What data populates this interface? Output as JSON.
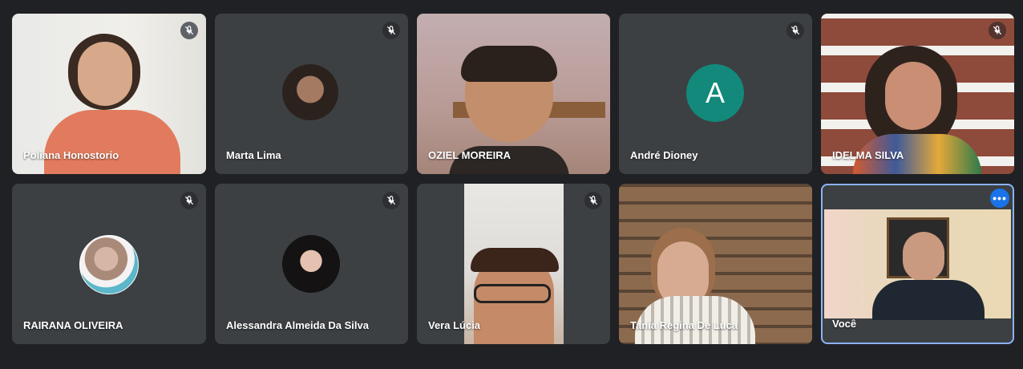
{
  "participants": [
    {
      "name": "Poliana Honostorio",
      "muted": true,
      "mode": "video"
    },
    {
      "name": "Marta Lima",
      "muted": true,
      "mode": "photo"
    },
    {
      "name": "OZIEL MOREIRA",
      "muted": false,
      "mode": "video"
    },
    {
      "name": "André Dioney",
      "muted": true,
      "mode": "letter",
      "initial": "A"
    },
    {
      "name": "IDELMA SILVA",
      "muted": true,
      "mode": "video"
    },
    {
      "name": "RAIRANA OLIVEIRA",
      "muted": true,
      "mode": "photo"
    },
    {
      "name": "Alessandra Almeida Da Silva",
      "muted": true,
      "mode": "photo"
    },
    {
      "name": "Vera Lúcia",
      "muted": true,
      "mode": "video"
    },
    {
      "name": "Tania Regina De Luca",
      "muted": false,
      "mode": "video"
    },
    {
      "name": "Você",
      "muted": false,
      "mode": "video",
      "self": true
    }
  ],
  "icons": {
    "mic_off": "mic-off-icon",
    "more": "more-options-icon"
  },
  "colors": {
    "background": "#202124",
    "tile": "#3c4043",
    "avatar_letter_bg": "#12897b",
    "self_outline": "#8ab4f8",
    "more_button": "#1a73e8"
  }
}
